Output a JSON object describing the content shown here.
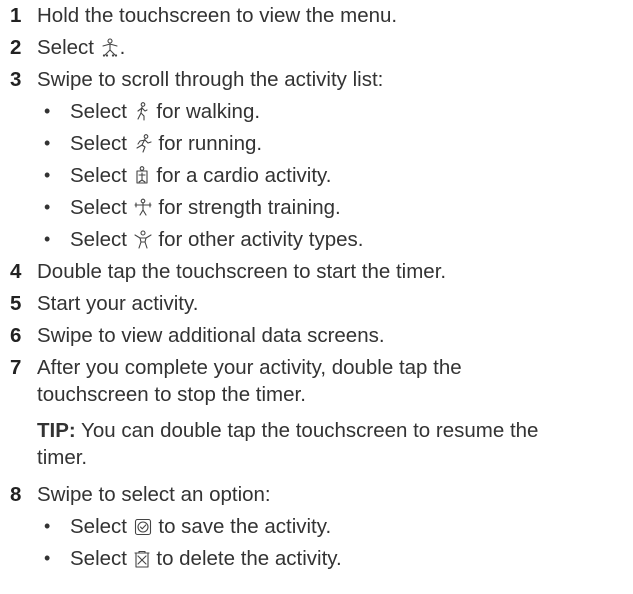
{
  "steps": [
    {
      "num": "1",
      "text": "Hold the touchscreen to view the menu."
    },
    {
      "num": "2",
      "before": "Select ",
      "after": ".",
      "icon": "activity-menu-icon"
    },
    {
      "num": "3",
      "text": "Swipe to scroll through the activity list:"
    },
    {
      "num": "4",
      "text": "Double tap the touchscreen to start the timer."
    },
    {
      "num": "5",
      "text": "Start your activity."
    },
    {
      "num": "6",
      "text": "Swipe to view additional data screens."
    },
    {
      "num": "7",
      "line1": "After you complete your activity, double tap the",
      "line2": "touchscreen to stop the timer."
    },
    {
      "num": "8",
      "text": "Swipe to select an option:"
    }
  ],
  "activities": [
    {
      "before": "Select ",
      "after": " for walking.",
      "icon": "walking-icon"
    },
    {
      "before": "Select ",
      "after": " for running.",
      "icon": "running-icon"
    },
    {
      "before": "Select ",
      "after": " for a cardio activity.",
      "icon": "cardio-icon"
    },
    {
      "before": "Select ",
      "after": " for strength training.",
      "icon": "strength-icon"
    },
    {
      "before": "Select ",
      "after": " for other activity types.",
      "icon": "other-activity-icon"
    }
  ],
  "tip": {
    "label": "TIP:",
    "line1": " You can double tap the touchscreen to resume the",
    "line2": "timer."
  },
  "options": [
    {
      "before": "Select ",
      "after": " to save the activity.",
      "icon": "save-check-icon"
    },
    {
      "before": "Select ",
      "after": " to delete the activity.",
      "icon": "delete-trash-icon"
    }
  ],
  "bullet": "•"
}
